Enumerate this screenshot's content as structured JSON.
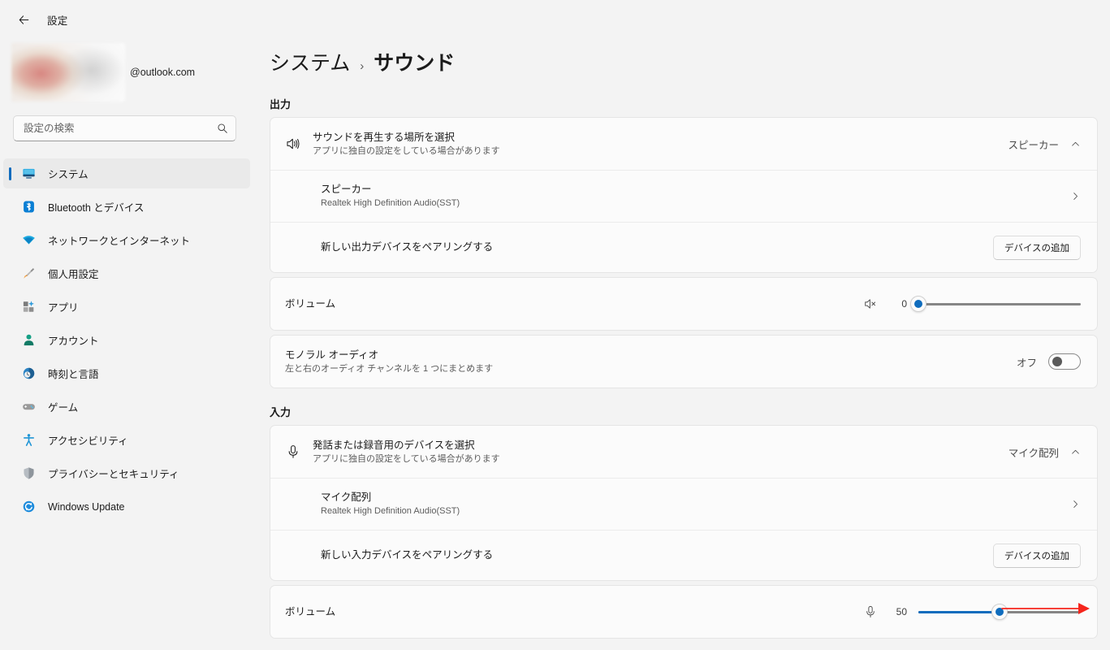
{
  "window": {
    "title": "設定",
    "back_icon": "back-arrow-icon"
  },
  "sidebar": {
    "account": {
      "email": "@outlook.com",
      "avatar": "blurred-profile-photo"
    },
    "search": {
      "placeholder": "設定の検索",
      "value": "",
      "icon": "search-icon"
    },
    "items": [
      {
        "label": "システム",
        "icon": "monitor-icon",
        "selected": true
      },
      {
        "label": "Bluetooth とデバイス",
        "icon": "bluetooth-icon",
        "selected": false
      },
      {
        "label": "ネットワークとインターネット",
        "icon": "wifi-icon",
        "selected": false
      },
      {
        "label": "個人用設定",
        "icon": "paintbrush-icon",
        "selected": false
      },
      {
        "label": "アプリ",
        "icon": "apps-grid-icon",
        "selected": false
      },
      {
        "label": "アカウント",
        "icon": "person-icon",
        "selected": false
      },
      {
        "label": "時刻と言語",
        "icon": "clock-icon",
        "selected": false
      },
      {
        "label": "ゲーム",
        "icon": "gamepad-icon",
        "selected": false
      },
      {
        "label": "アクセシビリティ",
        "icon": "accessibility-person-icon",
        "selected": false
      },
      {
        "label": "プライバシーとセキュリティ",
        "icon": "shield-icon",
        "selected": false
      },
      {
        "label": "Windows Update",
        "icon": "update-refresh-icon",
        "selected": false
      }
    ]
  },
  "breadcrumb": {
    "parent": "システム",
    "separator": "›",
    "current": "サウンド"
  },
  "output": {
    "section_label": "出力",
    "choose_device": {
      "title": "サウンドを再生する場所を選択",
      "subtitle": "アプリに独自の設定をしている場合があります",
      "value": "スピーカー",
      "icon": "speaker-waves-icon",
      "expand_icon": "chevron-up-icon"
    },
    "device": {
      "title": "スピーカー",
      "subtitle": "Realtek High Definition Audio(SST)",
      "chevron": "chevron-right-icon"
    },
    "pair": {
      "label": "新しい出力デバイスをペアリングする",
      "button": "デバイスの追加"
    },
    "volume": {
      "label": "ボリューム",
      "value": 0,
      "min": 0,
      "max": 100,
      "icon": "speaker-muted-icon"
    },
    "mono": {
      "title": "モノラル オーディオ",
      "subtitle": "左と右のオーディオ チャンネルを 1 つにまとめます",
      "state_label": "オフ",
      "enabled": false
    }
  },
  "input": {
    "section_label": "入力",
    "choose_device": {
      "title": "発話または録音用のデバイスを選択",
      "subtitle": "アプリに独自の設定をしている場合があります",
      "value": "マイク配列",
      "icon": "microphone-icon",
      "expand_icon": "chevron-up-icon"
    },
    "device": {
      "title": "マイク配列",
      "subtitle": "Realtek High Definition Audio(SST)",
      "chevron": "chevron-right-icon"
    },
    "pair": {
      "label": "新しい入力デバイスをペアリングする",
      "button": "デバイスの追加"
    },
    "volume": {
      "label": "ボリューム",
      "value": 50,
      "min": 0,
      "max": 100,
      "icon": "microphone-icon"
    }
  },
  "annotation": {
    "type": "drag-right-arrow",
    "color": "#f5251c",
    "target": "input-volume-slider"
  },
  "colors": {
    "accent": "#0f6cbd",
    "page_bg": "#f3f3f3",
    "card_bg": "#fbfbfb",
    "annotation_red": "#f5251c"
  }
}
